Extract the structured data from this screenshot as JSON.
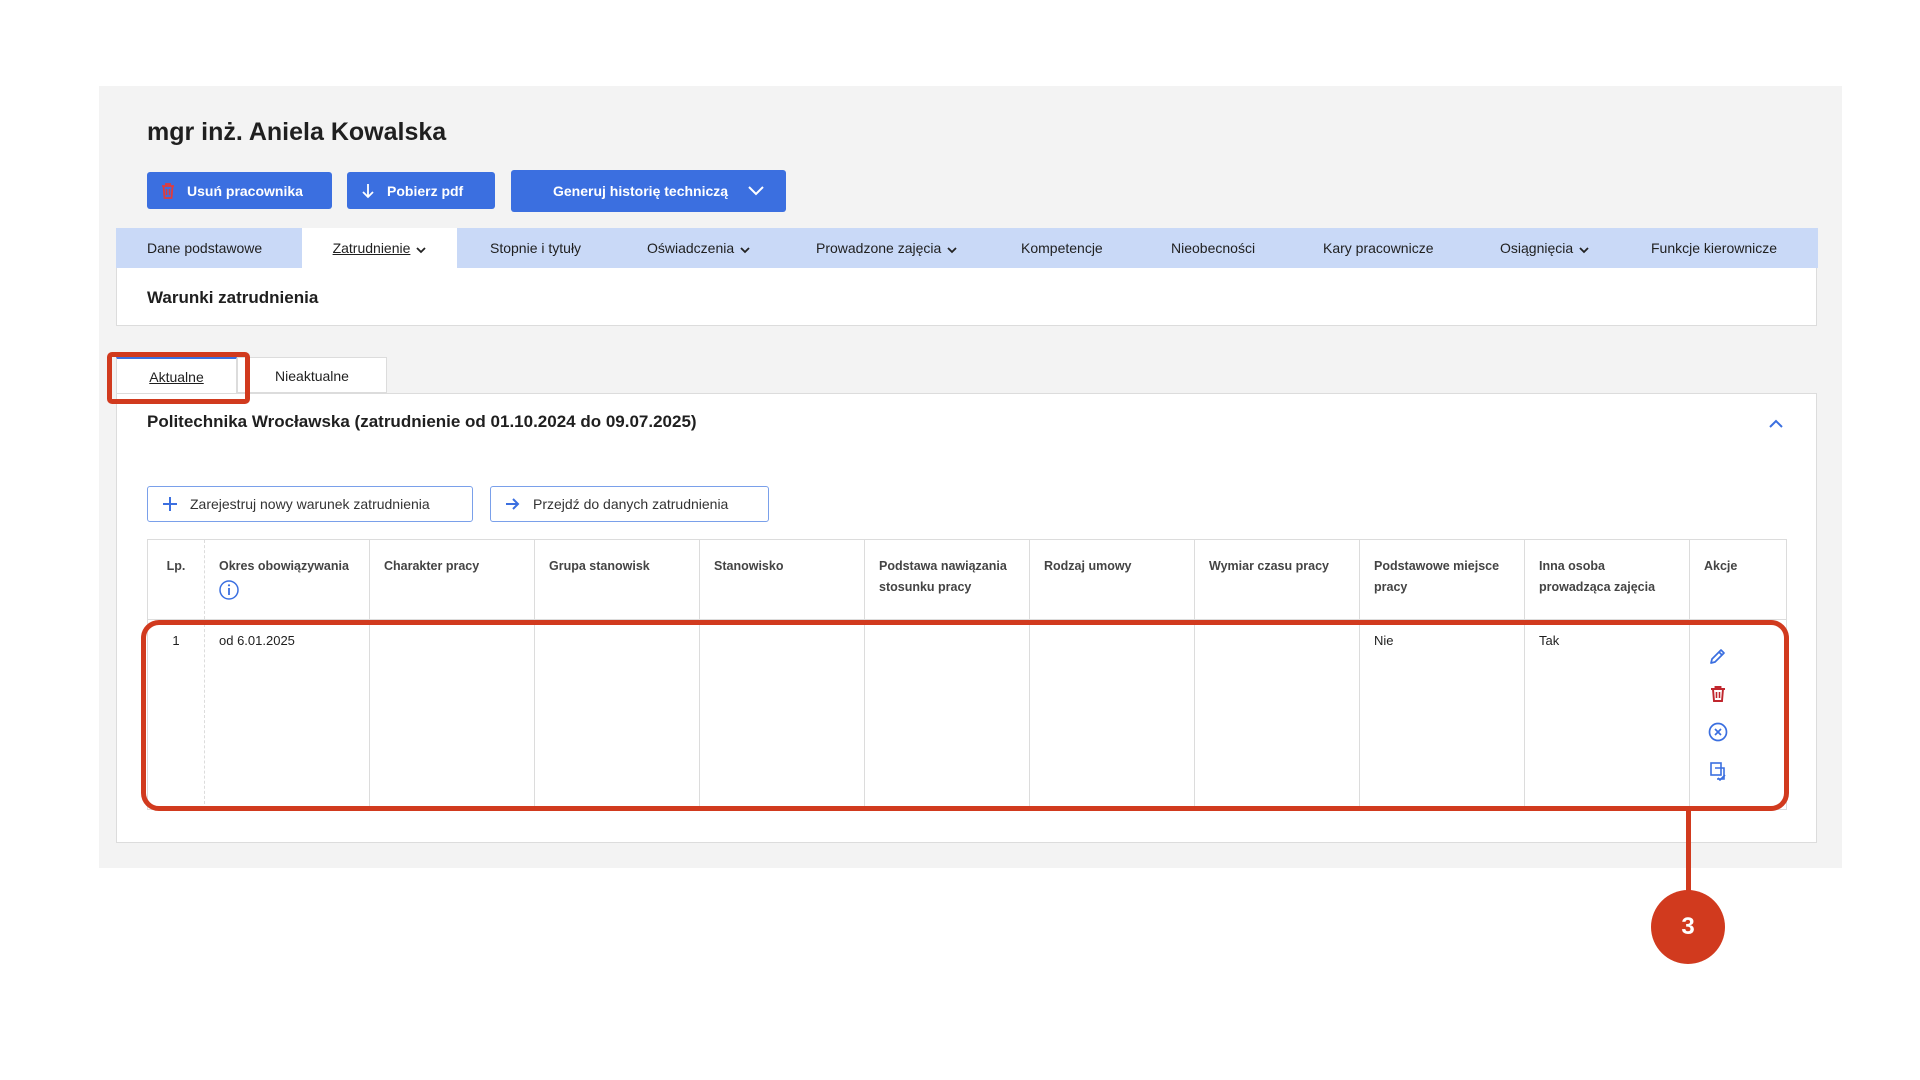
{
  "employee": {
    "name": "mgr inż. Aniela Kowalska"
  },
  "toolbar": {
    "delete_label": "Usuń pracownika",
    "pdf_label": "Pobierz pdf",
    "generate_label": "Generuj historię techniczą"
  },
  "nav": {
    "items": [
      {
        "label": "Dane podstawowe",
        "dropdown": false
      },
      {
        "label": "Zatrudnienie",
        "dropdown": true,
        "active": true
      },
      {
        "label": "Stopnie i tytuły",
        "dropdown": false
      },
      {
        "label": "Oświadczenia",
        "dropdown": true
      },
      {
        "label": "Prowadzone zajęcia",
        "dropdown": true
      },
      {
        "label": "Kompetencje",
        "dropdown": false
      },
      {
        "label": "Nieobecności",
        "dropdown": false
      },
      {
        "label": "Kary pracownicze",
        "dropdown": false
      },
      {
        "label": "Osiągnięcia",
        "dropdown": true
      },
      {
        "label": "Funkcje kierownicze",
        "dropdown": false
      }
    ]
  },
  "section": {
    "title": "Warunki zatrudnienia"
  },
  "tabs": [
    {
      "label": "Aktualne",
      "active": true
    },
    {
      "label": "Nieaktualne",
      "active": false
    }
  ],
  "employment": {
    "title": "Politechnika Wrocławska (zatrudnienie od 01.10.2024 do 09.07.2025)",
    "register_label": "Zarejestruj nowy warunek zatrudnienia",
    "goto_label": "Przejdź do danych zatrudnienia"
  },
  "table": {
    "headers": [
      "Lp.",
      "Okres obowiązywania",
      "Charakter pracy",
      "Grupa stanowisk",
      "Stanowisko",
      "Podstawa nawiązania stosunku pracy",
      "Rodzaj umowy",
      "Wymiar czasu pracy",
      "Podstawowe miejsce pracy",
      "Inna osoba prowadząca zajęcia",
      "Akcje"
    ],
    "rows": [
      [
        "1",
        "od 6.01.2025",
        "",
        "",
        "",
        "",
        "",
        "",
        "Nie",
        "Tak"
      ]
    ],
    "actions": [
      "edit-icon",
      "trash-icon",
      "cancel-circle-icon",
      "copy-icon"
    ]
  },
  "annotation": {
    "number": "3",
    "color": "#d13a1e"
  },
  "colors": {
    "primary": "#3b6fe0",
    "nav_bg": "#c9d9f7",
    "danger": "#c0262d",
    "highlight": "#d13a1e"
  }
}
